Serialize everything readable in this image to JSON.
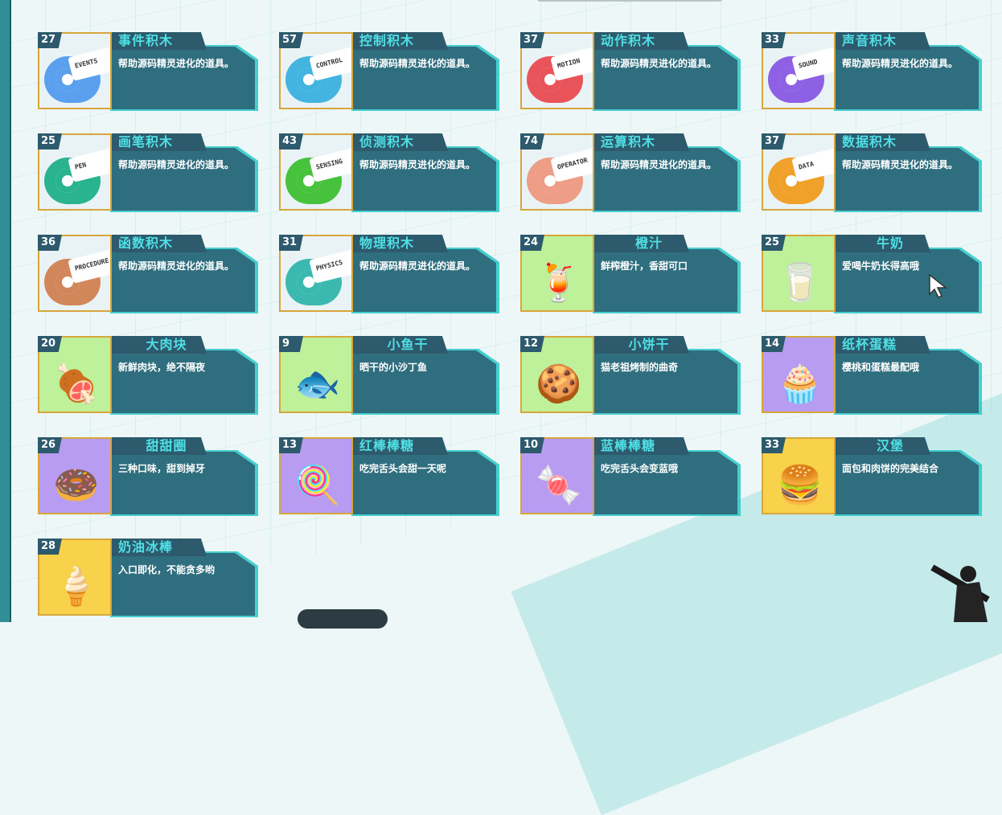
{
  "items": [
    {
      "count": "27",
      "title": "事件积木",
      "desc": "帮助源码精灵进化的道具。",
      "kind": "block",
      "color": "#5aa0ee",
      "icon": "toggle-icon",
      "label": "EVENTS"
    },
    {
      "count": "57",
      "title": "控制积木",
      "desc": "帮助源码精灵进化的道具。",
      "kind": "block",
      "color": "#43b4e0",
      "icon": "gamepad-icon",
      "label": "CONTROL"
    },
    {
      "count": "37",
      "title": "动作积木",
      "desc": "帮助源码精灵进化的道具。",
      "kind": "block",
      "color": "#e9535a",
      "icon": "ghost-icon",
      "label": "MOTION"
    },
    {
      "count": "33",
      "title": "声音积木",
      "desc": "帮助源码精灵进化的道具。",
      "kind": "block",
      "color": "#8d60e4",
      "icon": "microphone-icon",
      "label": "SOUND"
    },
    {
      "count": "25",
      "title": "画笔积木",
      "desc": "帮助源码精灵进化的道具。",
      "kind": "block",
      "color": "#2ab38f",
      "icon": "pen-icon",
      "label": "PEN"
    },
    {
      "count": "43",
      "title": "侦测积木",
      "desc": "帮助源码精灵进化的道具。",
      "kind": "block",
      "color": "#47c23c",
      "icon": "radar-icon",
      "label": "SENSING"
    },
    {
      "count": "74",
      "title": "运算积木",
      "desc": "帮助源码精灵进化的道具。",
      "kind": "block",
      "color": "#ee9d86",
      "icon": "calculator-icon",
      "label": "OPERATOR"
    },
    {
      "count": "37",
      "title": "数据积木",
      "desc": "帮助源码精灵进化的道具。",
      "kind": "block",
      "color": "#f0a12a",
      "icon": "bar-chart-icon",
      "label": "DATA"
    },
    {
      "count": "36",
      "title": "函数积木",
      "desc": "帮助源码精灵进化的道具。",
      "kind": "block",
      "color": "#d2875a",
      "icon": "function-icon",
      "label": "PROCEDURE"
    },
    {
      "count": "31",
      "title": "物理积木",
      "desc": "帮助源码精灵进化的道具。",
      "kind": "block",
      "color": "#3bb9b0",
      "icon": "magnet-icon",
      "label": "PHYSICS"
    },
    {
      "count": "24",
      "title": "橙汁",
      "desc": "鲜榨橙汁，香甜可口",
      "kind": "food",
      "bg": "#bff09a",
      "emoji": "🍹",
      "icon": "orange-juice-icon"
    },
    {
      "count": "25",
      "title": "牛奶",
      "desc": "爱喝牛奶长得高哦",
      "kind": "food",
      "bg": "#bff09a",
      "emoji": "🥛",
      "icon": "milk-carton-icon"
    },
    {
      "count": "20",
      "title": "大肉块",
      "desc": "新鲜肉块，绝不隔夜",
      "kind": "food",
      "bg": "#bff09a",
      "emoji": "🍖",
      "icon": "meat-icon"
    },
    {
      "count": "9",
      "title": "小鱼干",
      "desc": "晒干的小沙丁鱼",
      "kind": "food",
      "bg": "#bff09a",
      "emoji": "🐟",
      "icon": "fish-icon"
    },
    {
      "count": "12",
      "title": "小饼干",
      "desc": "猫老祖烤制的曲奇",
      "kind": "food",
      "bg": "#bff09a",
      "emoji": "🍪",
      "icon": "cookie-icon"
    },
    {
      "count": "14",
      "title": "纸杯蛋糕",
      "desc": "樱桃和蛋糕最配哦",
      "kind": "food",
      "bg": "#b89cf2",
      "emoji": "🧁",
      "icon": "cupcake-icon"
    },
    {
      "count": "26",
      "title": "甜甜圈",
      "desc": "三种口味，甜到掉牙",
      "kind": "food",
      "bg": "#b89cf2",
      "emoji": "🍩",
      "icon": "donut-icon"
    },
    {
      "count": "13",
      "title": "红棒棒糖",
      "desc": "吃完舌头会甜一天呢",
      "kind": "food",
      "bg": "#b89cf2",
      "emoji": "🍭",
      "icon": "lollipop-red-icon"
    },
    {
      "count": "10",
      "title": "蓝棒棒糖",
      "desc": "吃完舌头会变蓝哦",
      "kind": "food",
      "bg": "#b89cf2",
      "emoji": "🍬",
      "icon": "lollipop-blue-icon"
    },
    {
      "count": "33",
      "title": "汉堡",
      "desc": "面包和肉饼的完美结合",
      "kind": "food",
      "bg": "#f7d24a",
      "emoji": "🍔",
      "icon": "burger-icon"
    },
    {
      "count": "28",
      "title": "奶油冰棒",
      "desc": "入口即化，不能贪多哟",
      "kind": "food",
      "bg": "#f7d24a",
      "emoji": "🍦",
      "icon": "ice-cream-bar-icon"
    }
  ]
}
